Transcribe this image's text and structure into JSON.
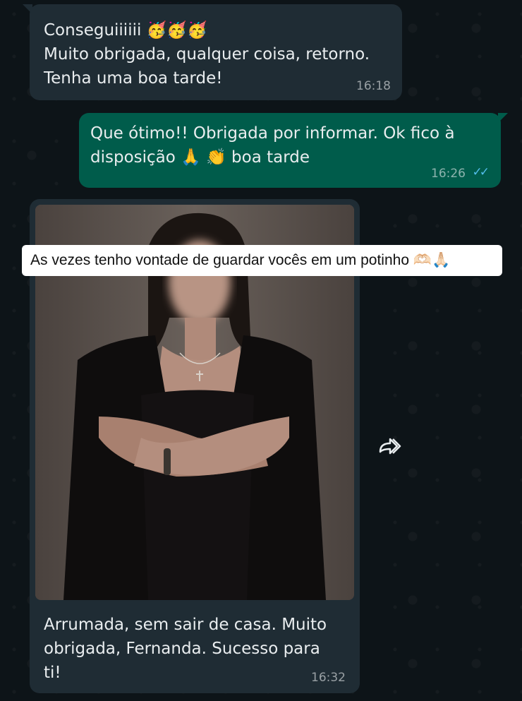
{
  "messages": [
    {
      "direction": "incoming",
      "lines": [
        "Conseguiiiiii 🥳🥳🥳",
        "Muito obrigada, qualquer coisa, retorno.",
        "Tenha uma boa tarde!"
      ],
      "time": "16:18"
    },
    {
      "direction": "outgoing",
      "lines": [
        "Que ótimo!! Obrigada por informar. Ok fico à",
        "disposição 🙏 👏 boa tarde"
      ],
      "time": "16:26",
      "status": "read"
    },
    {
      "direction": "incoming",
      "type": "image",
      "caption_lines": [
        "Arrumada, sem sair de casa. Muito",
        "obrigada, Fernanda. Sucesso para",
        "ti!"
      ],
      "time": "16:32"
    }
  ],
  "overlay": {
    "text": "As vezes tenho vontade de guardar vocês em um potinho 🫶🏻🙏🏻"
  },
  "icons": {
    "forward": "forward-icon",
    "read_receipt": "double-check-icon"
  },
  "colors": {
    "incoming_bubble": "#1f2c34",
    "outgoing_bubble": "#005c4b",
    "read_tick": "#53bdeb"
  }
}
